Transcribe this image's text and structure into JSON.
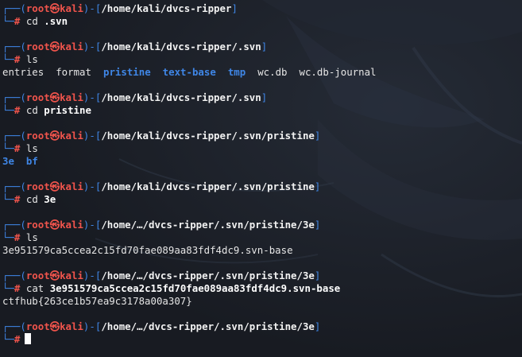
{
  "prompt": {
    "open": "┌──(",
    "user": "root",
    "skull": "㉿",
    "host": "kali",
    "mid": ")-[",
    "close": "]",
    "line2": "└─",
    "symbol": "#"
  },
  "blocks": [
    {
      "path": "/home/kali/dvcs-ripper",
      "command": "cd",
      "arg": ".svn",
      "output": []
    },
    {
      "path": "/home/kali/dvcs-ripper/.svn",
      "command": "ls",
      "arg": "",
      "output": [
        {
          "text": "entries",
          "type": "file"
        },
        {
          "text": "format",
          "type": "file"
        },
        {
          "text": "pristine",
          "type": "dir"
        },
        {
          "text": "text-base",
          "type": "dir"
        },
        {
          "text": "tmp",
          "type": "dir"
        },
        {
          "text": "wc.db",
          "type": "file"
        },
        {
          "text": "wc.db-journal",
          "type": "file"
        }
      ]
    },
    {
      "path": "/home/kali/dvcs-ripper/.svn",
      "command": "cd",
      "arg": "pristine",
      "output": []
    },
    {
      "path": "/home/kali/dvcs-ripper/.svn/pristine",
      "command": "ls",
      "arg": "",
      "output": [
        {
          "text": "3e",
          "type": "dir"
        },
        {
          "text": "bf",
          "type": "dir"
        }
      ]
    },
    {
      "path": "/home/kali/dvcs-ripper/.svn/pristine",
      "command": "cd",
      "arg": "3e",
      "output": []
    },
    {
      "path": "/home/…/dvcs-ripper/.svn/pristine/3e",
      "command": "ls",
      "arg": "",
      "output": [
        {
          "text": "3e951579ca5ccea2c15fd70fae089aa83fdf4dc9.svn-base",
          "type": "file"
        }
      ]
    },
    {
      "path": "/home/…/dvcs-ripper/.svn/pristine/3e",
      "command": "cat",
      "arg": "3e951579ca5ccea2c15fd70fae089aa83fdf4dc9.svn-base",
      "output": [
        {
          "text": "ctfhub{263ce1b57ea9c3178a00a307}",
          "type": "file"
        }
      ],
      "no_gap_before_output": true
    },
    {
      "path": "/home/…/dvcs-ripper/.svn/pristine/3e",
      "command": "",
      "arg": "",
      "output": [],
      "current": true
    }
  ],
  "colors": {
    "background": "#1c2028",
    "accent_blue": "#3f86e6",
    "accent_red": "#f0544c"
  }
}
